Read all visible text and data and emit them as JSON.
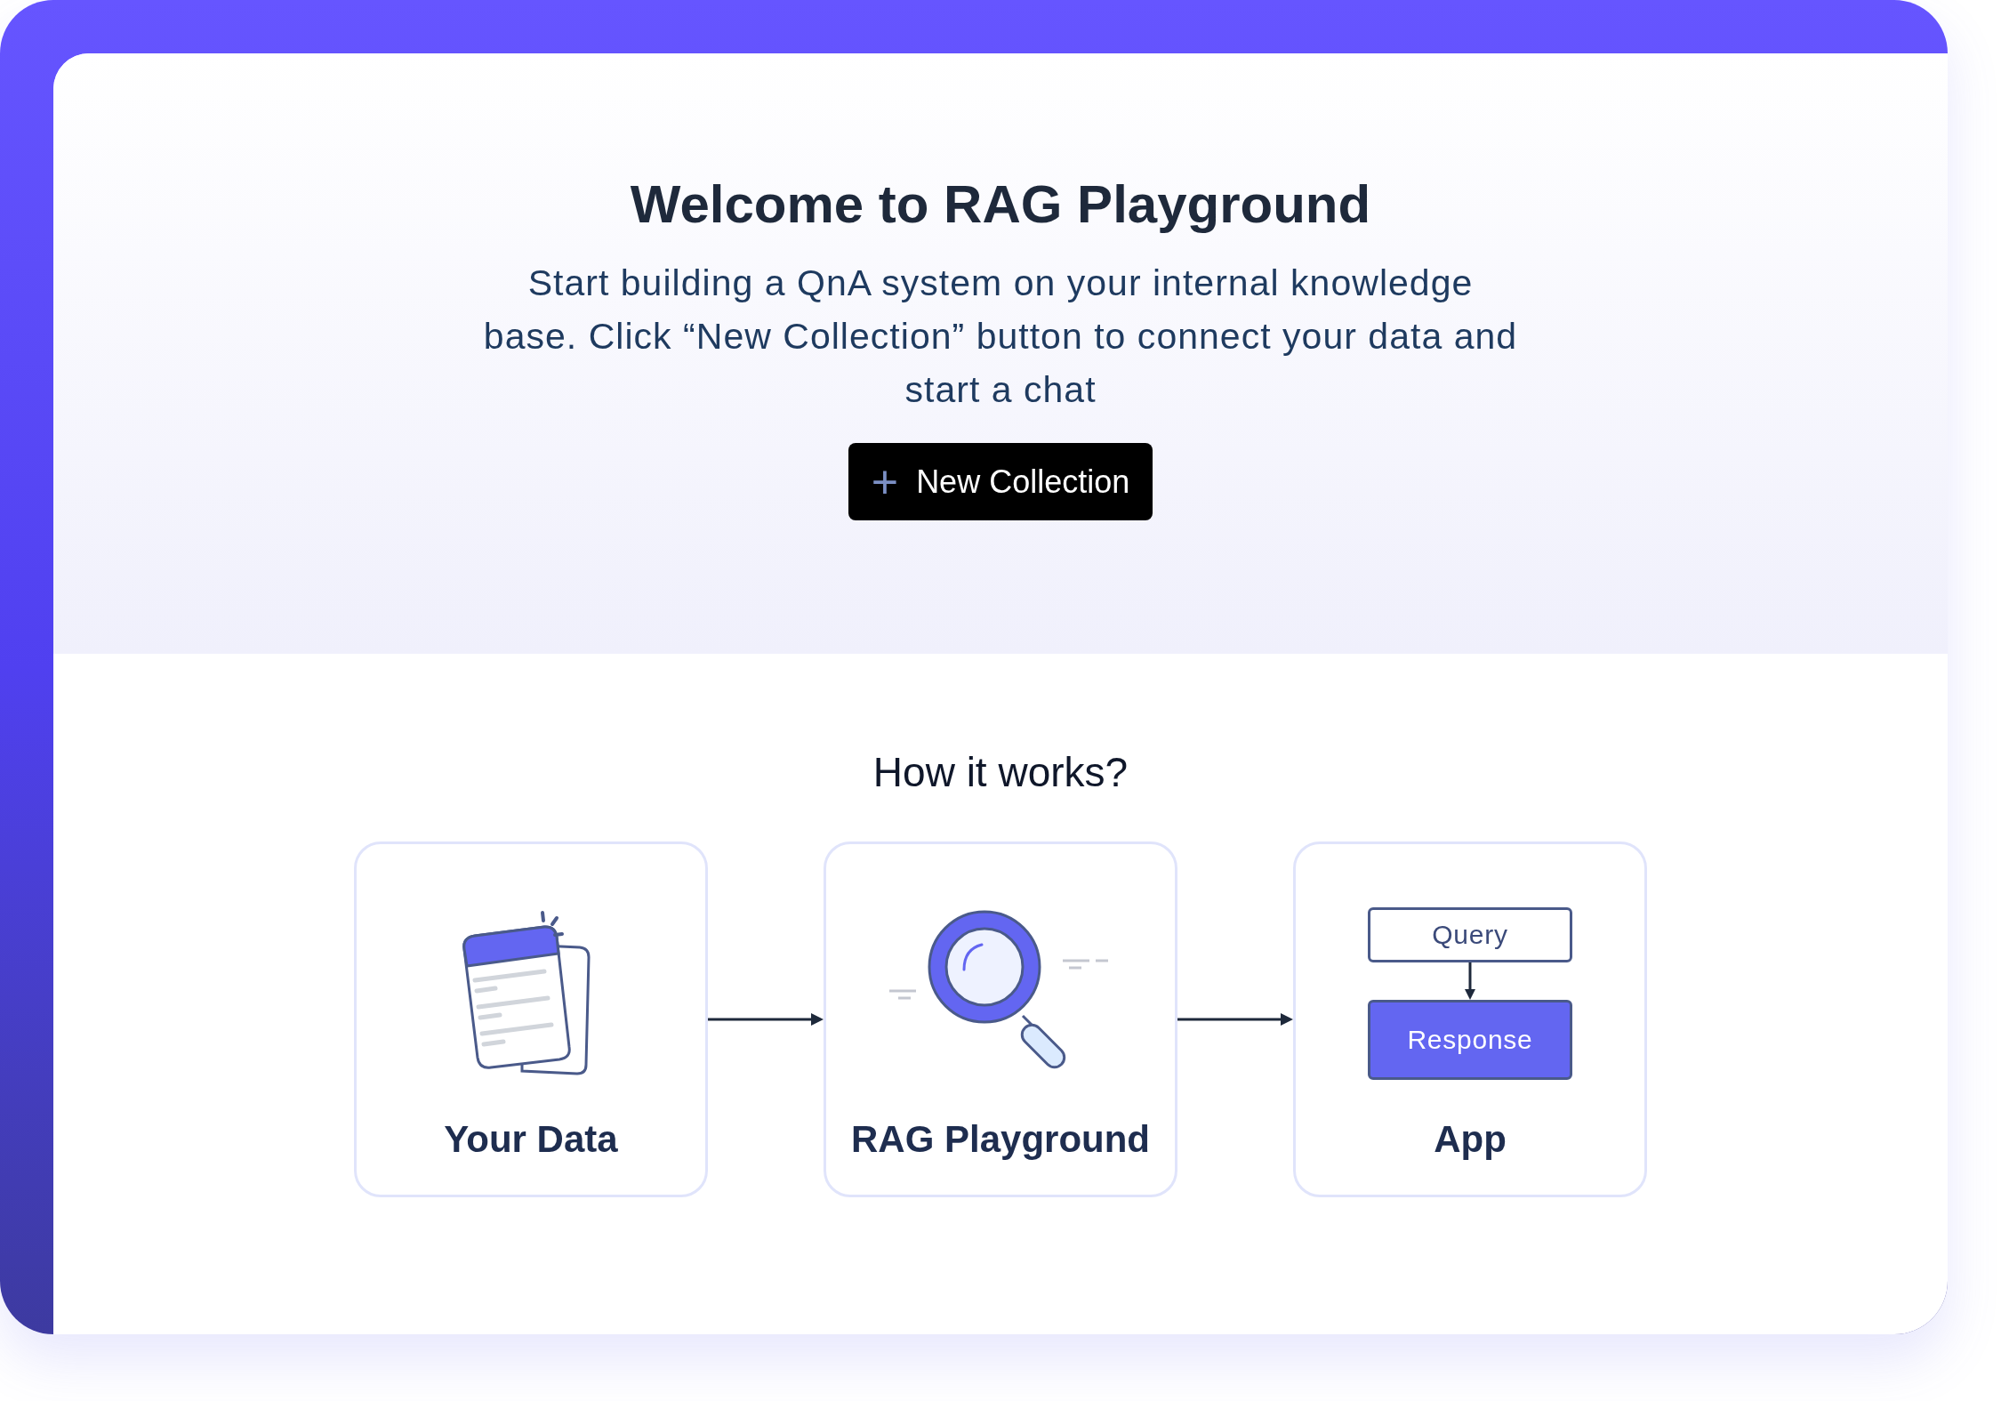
{
  "hero": {
    "title": "Welcome to RAG Playground",
    "description": "Start building a QnA system on your internal knowledge base. Click “New Collection” button to connect your data and start a chat",
    "button": {
      "icon": "+",
      "label": "New Collection"
    }
  },
  "how_it_works": {
    "title": "How it works?",
    "steps": [
      {
        "kind": "data",
        "label": "Your Data"
      },
      {
        "kind": "search",
        "label": "RAG Playground"
      },
      {
        "kind": "app",
        "label": "App",
        "query": "Query",
        "response": "Response"
      }
    ]
  }
}
